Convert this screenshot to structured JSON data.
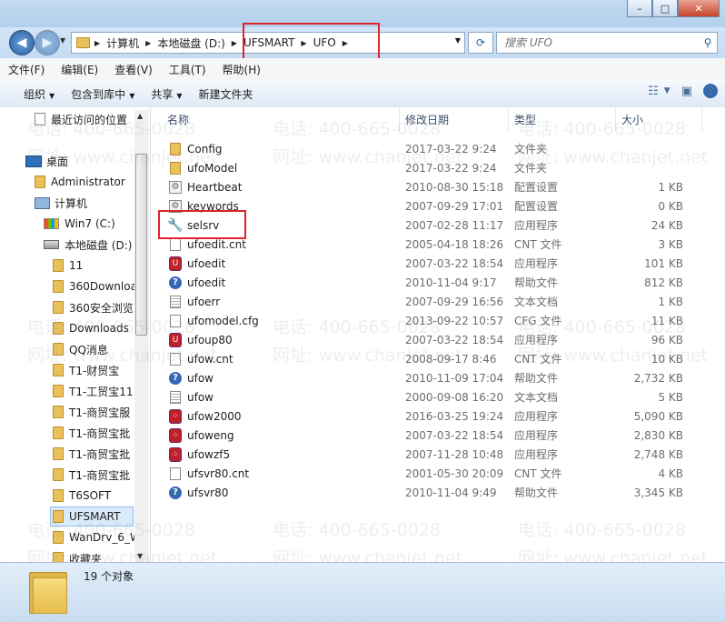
{
  "window": {
    "buttons": [
      "minimize",
      "maximize",
      "close"
    ]
  },
  "address_bar": {
    "breadcrumbs": [
      "计算机",
      "本地磁盘 (D:)",
      "UFSMART",
      "UFO"
    ],
    "search_placeholder": "搜索 UFO"
  },
  "menu": [
    "文件(F)",
    "编辑(E)",
    "查看(V)",
    "工具(T)",
    "帮助(H)"
  ],
  "toolbar": [
    "组织",
    "包含到库中",
    "共享",
    "新建文件夹"
  ],
  "nav": {
    "items": [
      {
        "label": "最近访问的位置",
        "icon": "recent-places-icon"
      },
      {
        "label": "桌面",
        "icon": "desktop-icon"
      },
      {
        "label": "Administrator",
        "icon": "user-folder-icon"
      },
      {
        "label": "计算机",
        "icon": "computer-icon"
      },
      {
        "label": "Win7 (C:)",
        "icon": "drive-c-icon"
      },
      {
        "label": "本地磁盘 (D:)",
        "icon": "drive-d-icon"
      },
      {
        "label": "11",
        "icon": "folder-icon"
      },
      {
        "label": "360Downloa",
        "icon": "folder-icon"
      },
      {
        "label": "360安全浏览",
        "icon": "folder-icon"
      },
      {
        "label": "Downloads",
        "icon": "folder-icon"
      },
      {
        "label": "QQ消息",
        "icon": "folder-icon"
      },
      {
        "label": "T1-财贸宝",
        "icon": "folder-icon"
      },
      {
        "label": "T1-工贸宝11",
        "icon": "folder-icon"
      },
      {
        "label": "T1-商贸宝服",
        "icon": "folder-icon"
      },
      {
        "label": "T1-商贸宝批",
        "icon": "folder-icon"
      },
      {
        "label": "T1-商贸宝批",
        "icon": "folder-icon"
      },
      {
        "label": "T1-商贸宝批",
        "icon": "folder-icon"
      },
      {
        "label": "T6SOFT",
        "icon": "folder-icon"
      },
      {
        "label": "UFSMART",
        "icon": "folder-icon"
      },
      {
        "label": "WanDrv_6_W",
        "icon": "folder-icon"
      },
      {
        "label": "收藏夹",
        "icon": "folder-icon"
      }
    ],
    "selected": "UFSMART"
  },
  "columns": [
    "名称",
    "修改日期",
    "类型",
    "大小"
  ],
  "files": [
    {
      "name": "Config",
      "date": "2017-03-22 9:24",
      "type": "文件夹",
      "size": "",
      "icon": "folder-icon"
    },
    {
      "name": "ufoModel",
      "date": "2017-03-22 9:24",
      "type": "文件夹",
      "size": "",
      "icon": "folder-icon"
    },
    {
      "name": "Heartbeat",
      "date": "2010-08-30 15:18",
      "type": "配置设置",
      "size": "1 KB",
      "icon": "config-file-icon"
    },
    {
      "name": "keywords",
      "date": "2007-09-29 17:01",
      "type": "配置设置",
      "size": "0 KB",
      "icon": "config-file-icon"
    },
    {
      "name": "selsrv",
      "date": "2007-02-28 11:17",
      "type": "应用程序",
      "size": "24 KB",
      "icon": "wrench-app-icon"
    },
    {
      "name": "ufoedit.cnt",
      "date": "2005-04-18 18:26",
      "type": "CNT 文件",
      "size": "3 KB",
      "icon": "blank-file-icon"
    },
    {
      "name": "ufoedit",
      "date": "2007-03-22 18:54",
      "type": "应用程序",
      "size": "101 KB",
      "icon": "ufo-app-icon"
    },
    {
      "name": "ufoedit",
      "date": "2010-11-04 9:17",
      "type": "帮助文件",
      "size": "812 KB",
      "icon": "help-file-icon"
    },
    {
      "name": "ufoerr",
      "date": "2007-09-29 16:56",
      "type": "文本文档",
      "size": "1 KB",
      "icon": "text-file-icon"
    },
    {
      "name": "ufomodel.cfg",
      "date": "2013-09-22 10:57",
      "type": "CFG 文件",
      "size": "11 KB",
      "icon": "blank-file-icon"
    },
    {
      "name": "ufoup80",
      "date": "2007-03-22 18:54",
      "type": "应用程序",
      "size": "96 KB",
      "icon": "ufo-app-icon"
    },
    {
      "name": "ufow.cnt",
      "date": "2008-09-17 8:46",
      "type": "CNT 文件",
      "size": "10 KB",
      "icon": "blank-file-icon"
    },
    {
      "name": "ufow",
      "date": "2010-11-09 17:04",
      "type": "帮助文件",
      "size": "2,732 KB",
      "icon": "help-file-icon"
    },
    {
      "name": "ufow",
      "date": "2000-09-08 16:20",
      "type": "文本文档",
      "size": "5 KB",
      "icon": "text-file-icon"
    },
    {
      "name": "ufow2000",
      "date": "2016-03-25 19:24",
      "type": "应用程序",
      "size": "5,090 KB",
      "icon": "dice-app-icon"
    },
    {
      "name": "ufoweng",
      "date": "2007-03-22 18:54",
      "type": "应用程序",
      "size": "2,830 KB",
      "icon": "dice-app-icon"
    },
    {
      "name": "ufowzf5",
      "date": "2007-11-28 10:48",
      "type": "应用程序",
      "size": "2,748 KB",
      "icon": "dice-app-icon"
    },
    {
      "name": "ufsvr80.cnt",
      "date": "2001-05-30 20:09",
      "type": "CNT 文件",
      "size": "4 KB",
      "icon": "blank-file-icon"
    },
    {
      "name": "ufsvr80",
      "date": "2010-11-04 9:49",
      "type": "帮助文件",
      "size": "3,345 KB",
      "icon": "help-file-icon"
    }
  ],
  "status": {
    "text": "19 个对象"
  },
  "watermark": {
    "phone": "电话: 400-665-0028",
    "site": "网址: www.chanjet.net"
  },
  "colors": {
    "highlight_box": "#e0232b",
    "selection": "#d9ebfb"
  }
}
